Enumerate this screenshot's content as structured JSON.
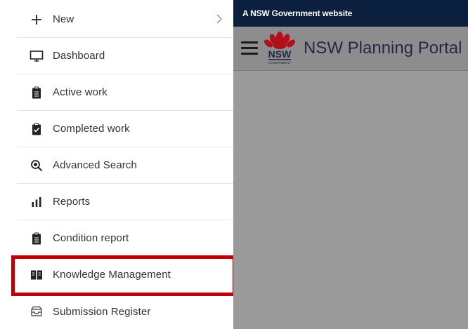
{
  "menu": {
    "items": [
      {
        "label": "New",
        "icon": "plus-icon"
      },
      {
        "label": "Dashboard",
        "icon": "monitor-icon"
      },
      {
        "label": "Active work",
        "icon": "clipboard-icon"
      },
      {
        "label": "Completed work",
        "icon": "clipboard-check-icon"
      },
      {
        "label": "Advanced Search",
        "icon": "search-icon"
      },
      {
        "label": "Reports",
        "icon": "bar-chart-icon"
      },
      {
        "label": "Condition report",
        "icon": "clipboard-icon"
      },
      {
        "label": "Knowledge Management",
        "icon": "book-icon"
      },
      {
        "label": "Submission Register",
        "icon": "inbox-icon"
      }
    ]
  },
  "portal": {
    "gov_banner": "A NSW Government website",
    "title": "NSW Planning Portal",
    "logo_text": "NSW"
  },
  "colors": {
    "highlight": "#c00000",
    "gov_bar": "#0b1f3f",
    "overlay": "#9a9a9a"
  }
}
